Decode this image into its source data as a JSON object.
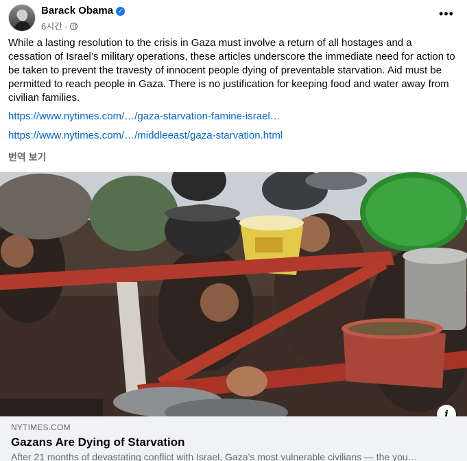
{
  "post": {
    "author": "Barack Obama",
    "verified_mark": "✓",
    "timestamp": "6시간",
    "separator": "·",
    "audience_icon": "globe-icon",
    "more_label": "•••",
    "body": "While a lasting resolution to the crisis in Gaza must involve a return of all hostages and a cessation of Israel’s military operations, these articles underscore the immediate need for action to be taken to prevent the travesty of innocent people dying of preventable starvation. Aid must be permitted to reach people in Gaza. There is no justification for keeping food and water away from civilian families.",
    "links": [
      "https://www.nytimes.com/…/gaza-starvation-famine-israel…",
      "https://www.nytimes.com/…/middleeast/gaza-starvation.html"
    ],
    "translate_label": "번역 보기"
  },
  "link_card": {
    "domain": "NYTIMES.COM",
    "title": "Gazans Are Dying of Starvation",
    "description": "After 21 months of devastating conflict with Israel, Gaza’s most vulnerable civilians — the you…",
    "info_label": "i"
  },
  "colors": {
    "link": "#0064d1",
    "verified": "#1877f2",
    "secondary_text": "#65676b",
    "card_background": "#f0f2f5"
  }
}
